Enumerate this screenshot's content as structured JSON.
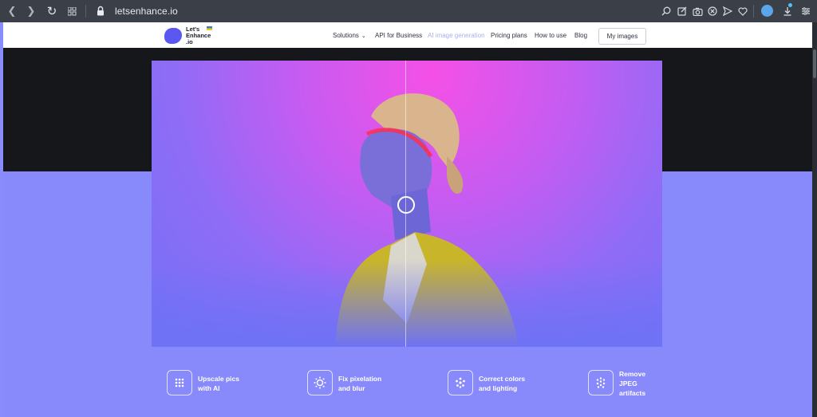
{
  "browser": {
    "url": "letsenhance.io",
    "icons": [
      "back-icon",
      "forward-icon",
      "reload-icon",
      "tabs-grid-icon",
      "lock-icon",
      "search-icon",
      "edit-icon",
      "camera-icon",
      "adblock-icon",
      "send-icon",
      "heart-icon",
      "profile-icon",
      "download-icon",
      "settings-icon"
    ]
  },
  "header": {
    "logo_text": "Let's\nEnhance\n.io",
    "nav": {
      "solutions": "Solutions",
      "api": "API for Business",
      "ai_generation": "AI image generation",
      "pricing": "Pricing plans",
      "howto": "How to use",
      "blog": "Blog"
    },
    "my_images": "My images"
  },
  "colors": {
    "brand": "#5a58f0",
    "page_purple": "#8889fb",
    "dark_band": "#16171a",
    "chrome": "#3b4048"
  },
  "features": [
    {
      "label": "Upscale pics\nwith AI",
      "icon": "upscale-icon"
    },
    {
      "label": "Fix pixelation\nand blur",
      "icon": "pixelation-icon"
    },
    {
      "label": "Correct colors\nand lighting",
      "icon": "colors-icon"
    },
    {
      "label": "Remove\nJPEG\nartifacts",
      "icon": "artifacts-icon"
    }
  ]
}
